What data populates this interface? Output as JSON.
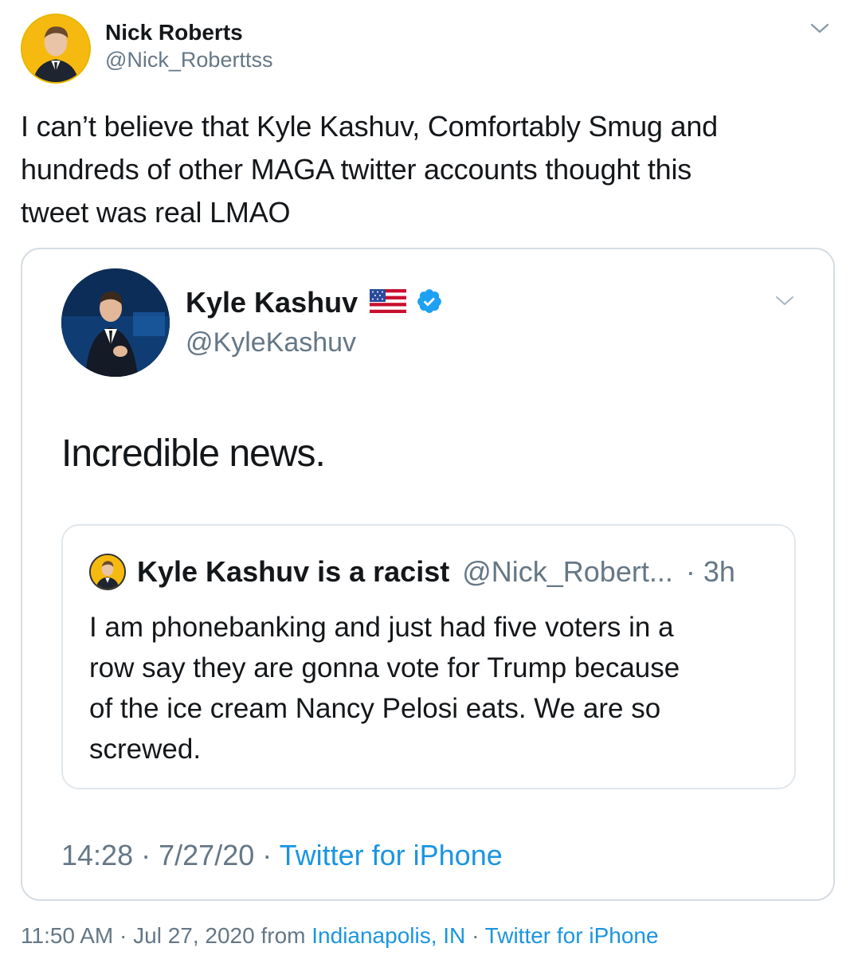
{
  "outer_tweet": {
    "author_name": "Nick Roberts",
    "author_handle": "@Nick_Roberttss",
    "text_line1": "I can’t believe that Kyle Kashuv, Comfortably Smug and",
    "text_line2": "hundreds of other MAGA twitter accounts thought this",
    "text_line3": "tweet was real LMAO",
    "time": "11:50 AM",
    "date": "Jul 27, 2020",
    "sep1": "·",
    "from_label": "from",
    "location": "Indianapolis, IN",
    "sep2": "·",
    "source": "Twitter for iPhone",
    "menu_icon": "chevron-down-icon"
  },
  "embedded_tweet": {
    "author_name": "Kyle Kashuv",
    "author_handle": "@KyleKashuv",
    "flag_icon": "us-flag-icon",
    "verified_icon": "verified-badge-icon",
    "text": "Incredible news.",
    "time": "14:28",
    "sep1": "·",
    "date": "7/27/20",
    "sep2": "·",
    "source": "Twitter for iPhone",
    "colors": {
      "verified": "#1da1f2",
      "link": "#1b95e0"
    }
  },
  "quoted_tweet": {
    "author_name": "Kyle Kashuv is a racist",
    "author_handle": "@Nick_Robert...",
    "age": "· 3h",
    "line1": "I am phonebanking and just had five voters in a",
    "line2": "row say they are gonna vote for Trump because",
    "line3": "of the ice cream Nancy Pelosi eats. We are so",
    "line4": "screwed."
  }
}
